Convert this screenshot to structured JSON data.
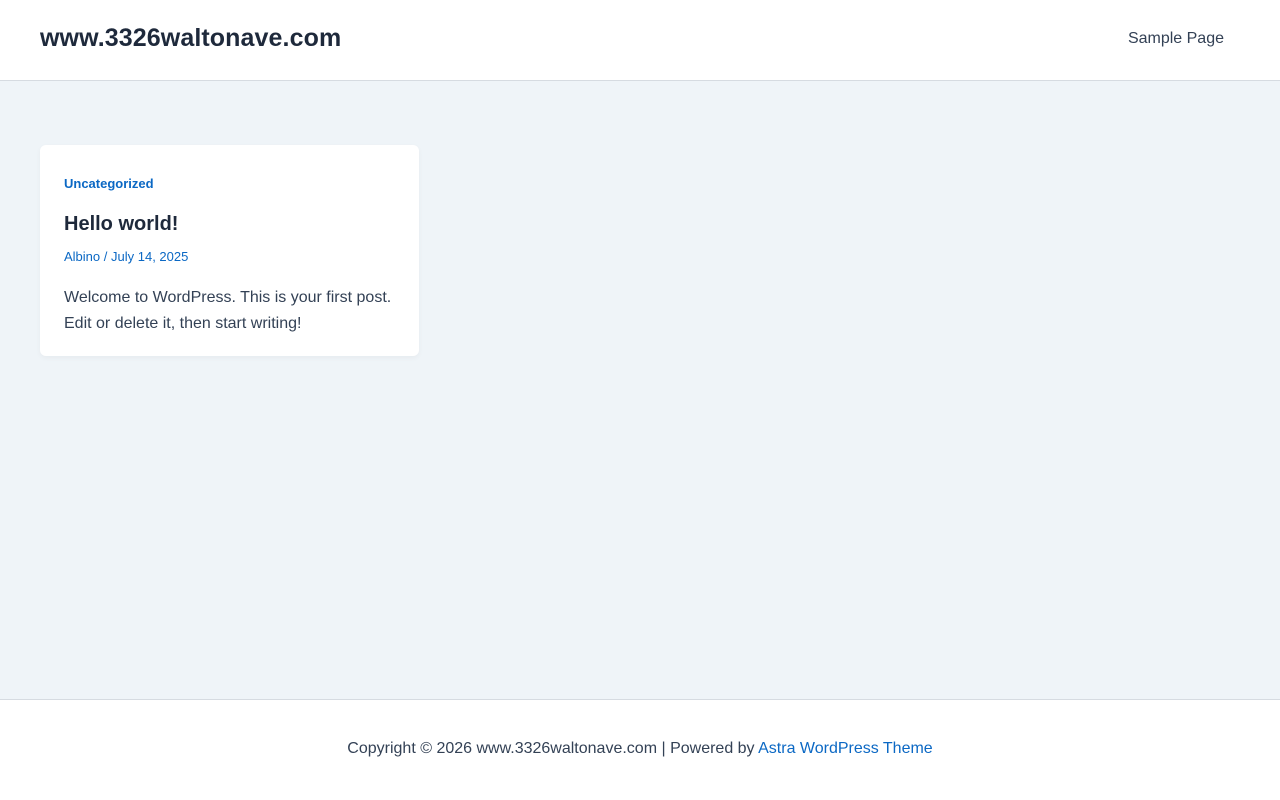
{
  "header": {
    "site_title": "www.3326waltonave.com",
    "nav": [
      {
        "label": "Sample Page"
      }
    ]
  },
  "posts": [
    {
      "category": "Uncategorized",
      "title": "Hello world!",
      "author": "Albino",
      "separator": "/",
      "date": "July 14, 2025",
      "excerpt": "Welcome to WordPress. This is your first post. Edit or delete it, then start writing!"
    }
  ],
  "footer": {
    "copyright_prefix": "Copyright © 2026 www.3326waltonave.com | Powered by",
    "theme_link": "Astra WordPress Theme"
  },
  "colors": {
    "accent": "#0b68c4",
    "heading": "#1e293b",
    "body_text": "#334155",
    "content_background": "#eff4f8",
    "border": "#d6dbe1"
  }
}
